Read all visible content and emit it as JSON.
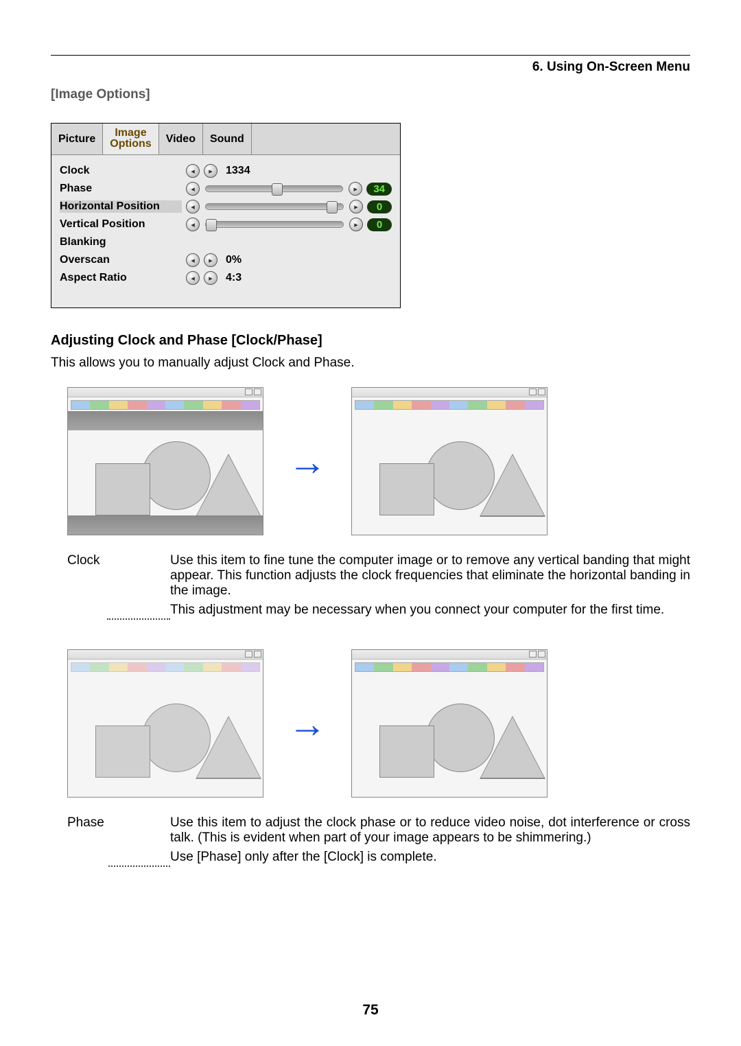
{
  "chapter": "6. Using On-Screen Menu",
  "section_title": "[Image Options]",
  "osd": {
    "tabs": [
      "Picture",
      "Image\nOptions",
      "Video",
      "Sound"
    ],
    "rows": {
      "clock": {
        "label": "Clock",
        "value": "1334"
      },
      "phase": {
        "label": "Phase",
        "badge": "34",
        "thumb_pct": 48
      },
      "hpos": {
        "label": "Horizontal Position",
        "badge": "0",
        "thumb_pct": 92
      },
      "vpos": {
        "label": "Vertical Position",
        "badge": "0",
        "thumb_pct": 2
      },
      "blanking": {
        "label": "Blanking"
      },
      "overscan": {
        "label": "Overscan",
        "value": "0%"
      },
      "aspect": {
        "label": "Aspect Ratio",
        "value": "4:3"
      }
    }
  },
  "subhead": "Adjusting Clock and Phase [Clock/Phase]",
  "intro": "This allows you to manually adjust Clock and Phase.",
  "defs": {
    "clock": {
      "label": "Clock",
      "p1": "Use this item to fine tune the computer image or to remove any vertical banding that might appear. This function adjusts the clock frequencies that eliminate the horizontal banding in the image.",
      "p2": "This adjustment may be necessary when you connect your computer for the first time."
    },
    "phase": {
      "label": "Phase",
      "p1": "Use this item to adjust the clock phase or to reduce video noise, dot interference or cross talk. (This is evident when part of your image appears to be shimmering.)",
      "p2": "Use [Phase] only after the [Clock] is complete."
    }
  },
  "page_number": "75"
}
